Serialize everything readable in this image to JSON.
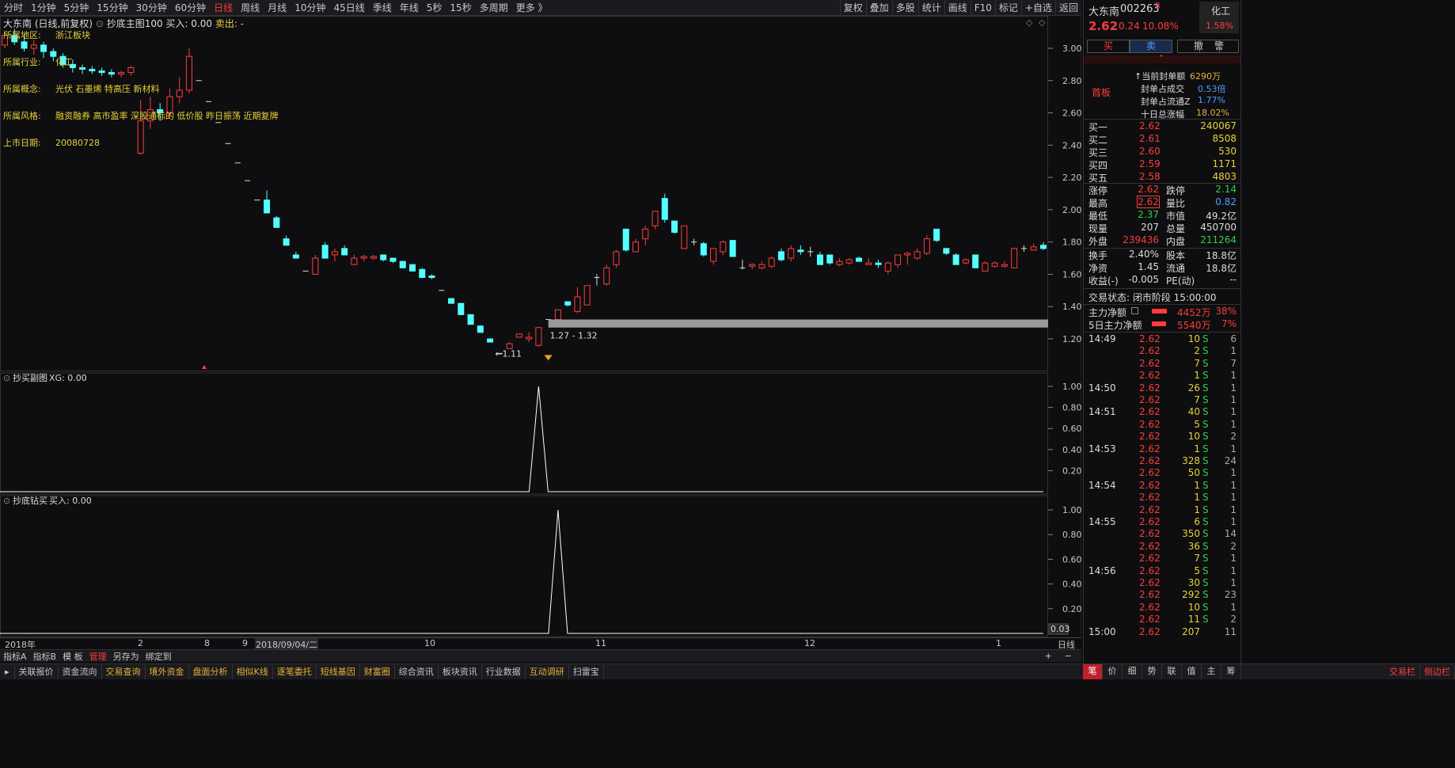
{
  "toolbar": {
    "periods": [
      "分时",
      "1分钟",
      "5分钟",
      "15分钟",
      "30分钟",
      "60分钟",
      "日线",
      "周线",
      "月线",
      "10分钟",
      "45日线",
      "季线",
      "年线",
      "5秒",
      "15秒",
      "多周期",
      "更多 》"
    ],
    "active_period": "日线",
    "right_tools": [
      "复权",
      "叠加",
      "多股",
      "统计",
      "画线",
      "F10",
      "标记",
      "+自选",
      "返回"
    ]
  },
  "chart_header": {
    "stock": "大东南 (日线,前复权)",
    "indicator": "抄底主图100",
    "buy": "买入: 0.00",
    "sell": "卖出: -"
  },
  "info": [
    {
      "k": "所属地区:",
      "v": "浙江板块"
    },
    {
      "k": "所属行业:",
      "v": "化工"
    },
    {
      "k": "所属概念:",
      "v": "光伏 石墨烯 特高压 新材料"
    },
    {
      "k": "所属风格:",
      "v": "融资融券 高市盈率 深股通标的 低价股 昨日振荡 近期复牌"
    },
    {
      "k": "上市日期:",
      "v": "20080728"
    }
  ],
  "price_axis": [
    "3.00",
    "2.80",
    "2.60",
    "2.40",
    "2.20",
    "2.00",
    "1.80",
    "1.60",
    "1.40",
    "1.20"
  ],
  "annotations": {
    "low_label": "1.11",
    "range_label": "1.27 - 1.32"
  },
  "sub1": {
    "title": "抄买副图",
    "value": "XG: 0.00",
    "axis": [
      "1.00",
      "0.80",
      "0.60",
      "0.40",
      "0.20"
    ]
  },
  "sub2": {
    "title": "抄底钻买",
    "value": "买入: 0.00",
    "axis": [
      "1.00",
      "0.80",
      "0.60",
      "0.40",
      "0.20"
    ],
    "corner": "0.03"
  },
  "date_axis": [
    {
      "t": "2018年"
    },
    {
      "t": "2"
    },
    {
      "t": "8"
    },
    {
      "t": "9"
    },
    {
      "t": "2018/09/04/二"
    },
    {
      "t": "10"
    },
    {
      "t": "11"
    },
    {
      "t": "12"
    },
    {
      "t": "1"
    }
  ],
  "date_axis_right": "日线",
  "tabs": [
    "指标A",
    "指标B",
    "模 板",
    "管理",
    "另存为",
    "绑定到"
  ],
  "tabs_active": "管理",
  "tabs_right": [
    "+",
    "−"
  ],
  "bottom": [
    "关联报价",
    "资金流向",
    "交易查询",
    "境外资金",
    "盘面分析",
    "相似K线",
    "逐笔委托",
    "短线基因",
    "财富圈",
    "综合资讯",
    "板块资讯",
    "行业数据",
    "互动调研",
    "扫雷宝"
  ],
  "bottom_right": [
    "交易栏",
    "侧边栏"
  ],
  "panel": {
    "name": "大东南",
    "code": "002263",
    "mark": "R",
    "sector": "化工",
    "price": "2.62",
    "change": "0.24",
    "pct": "10.08%",
    "sector_pct": "1.58%",
    "buttons": [
      "买",
      "卖",
      "撤",
      "警"
    ],
    "tag": "首板",
    "seal": [
      {
        "k": "当前封单额",
        "v": "6290万"
      },
      {
        "k": "封单占成交",
        "v": "0.53倍"
      },
      {
        "k": "封单占流通Z",
        "v": "1.77%"
      },
      {
        "k": "十日总涨幅",
        "v": "18.02%"
      }
    ],
    "bids": [
      {
        "k": "买一",
        "p": "2.62",
        "v": "240067"
      },
      {
        "k": "买二",
        "p": "2.61",
        "v": "8508"
      },
      {
        "k": "买三",
        "p": "2.60",
        "v": "530"
      },
      {
        "k": "买四",
        "p": "2.59",
        "v": "1171"
      },
      {
        "k": "买五",
        "p": "2.58",
        "v": "4803"
      }
    ],
    "stats": [
      {
        "k1": "涨停",
        "v1": "2.62",
        "k2": "跌停",
        "v2": "2.14"
      },
      {
        "k1": "最高",
        "v1": "2.62",
        "k2": "量比",
        "v2": "0.82"
      },
      {
        "k1": "最低",
        "v1": "2.37",
        "k2": "市值",
        "v2": "49.2亿"
      },
      {
        "k1": "现量",
        "v1": "207",
        "k2": "总量",
        "v2": "450700"
      },
      {
        "k1": "外盘",
        "v1": "239436",
        "k2": "内盘",
        "v2": "211264"
      }
    ],
    "stats2": [
      {
        "k1": "换手",
        "v1": "2.40%",
        "k2": "股本",
        "v2": "18.8亿"
      },
      {
        "k1": "净资",
        "v1": "1.45",
        "k2": "流通",
        "v2": "18.8亿"
      },
      {
        "k1": "收益(-)",
        "v1": "-0.005",
        "k2": "PE(动)",
        "v2": "--"
      }
    ],
    "status": "交易状态: 闭市阶段 15:00:00",
    "flows": [
      {
        "k": "主力净额",
        "v": "4452万",
        "p": "38%",
        "bar": 0.38
      },
      {
        "k": "5日主力净额",
        "v": "5540万",
        "p": "7%",
        "bar": 0.07
      }
    ],
    "ticks": [
      {
        "t": "14:49",
        "p": "2.62",
        "v": "10",
        "s": "S",
        "n": "6"
      },
      {
        "t": "",
        "p": "2.62",
        "v": "2",
        "s": "S",
        "n": "1"
      },
      {
        "t": "",
        "p": "2.62",
        "v": "7",
        "s": "S",
        "n": "7"
      },
      {
        "t": "",
        "p": "2.62",
        "v": "1",
        "s": "S",
        "n": "1"
      },
      {
        "t": "14:50",
        "p": "2.62",
        "v": "26",
        "s": "S",
        "n": "1"
      },
      {
        "t": "",
        "p": "2.62",
        "v": "7",
        "s": "S",
        "n": "1"
      },
      {
        "t": "14:51",
        "p": "2.62",
        "v": "40",
        "s": "S",
        "n": "1"
      },
      {
        "t": "",
        "p": "2.62",
        "v": "5",
        "s": "S",
        "n": "1"
      },
      {
        "t": "",
        "p": "2.62",
        "v": "10",
        "s": "S",
        "n": "2"
      },
      {
        "t": "14:53",
        "p": "2.62",
        "v": "1",
        "s": "S",
        "n": "1"
      },
      {
        "t": "",
        "p": "2.62",
        "v": "328",
        "s": "S",
        "n": "24"
      },
      {
        "t": "",
        "p": "2.62",
        "v": "50",
        "s": "S",
        "n": "1"
      },
      {
        "t": "14:54",
        "p": "2.62",
        "v": "1",
        "s": "S",
        "n": "1"
      },
      {
        "t": "",
        "p": "2.62",
        "v": "1",
        "s": "S",
        "n": "1"
      },
      {
        "t": "",
        "p": "2.62",
        "v": "1",
        "s": "S",
        "n": "1"
      },
      {
        "t": "14:55",
        "p": "2.62",
        "v": "6",
        "s": "S",
        "n": "1"
      },
      {
        "t": "",
        "p": "2.62",
        "v": "350",
        "s": "S",
        "n": "14"
      },
      {
        "t": "",
        "p": "2.62",
        "v": "36",
        "s": "S",
        "n": "2"
      },
      {
        "t": "",
        "p": "2.62",
        "v": "7",
        "s": "S",
        "n": "1"
      },
      {
        "t": "14:56",
        "p": "2.62",
        "v": "5",
        "s": "S",
        "n": "1"
      },
      {
        "t": "",
        "p": "2.62",
        "v": "30",
        "s": "S",
        "n": "1"
      },
      {
        "t": "",
        "p": "2.62",
        "v": "292",
        "s": "S",
        "n": "23"
      },
      {
        "t": "",
        "p": "2.62",
        "v": "10",
        "s": "S",
        "n": "1"
      },
      {
        "t": "",
        "p": "2.62",
        "v": "11",
        "s": "S",
        "n": "2"
      },
      {
        "t": "15:00",
        "p": "2.62",
        "v": "207",
        "s": "",
        "n": "11"
      }
    ],
    "bottom_tabs": [
      "笔",
      "价",
      "细",
      "势",
      "联",
      "值",
      "主",
      "筹"
    ],
    "bottom_active": "笔"
  },
  "colors": {
    "up": "#ff3b3b",
    "down": "#54ffff",
    "bg": "#0e0e10",
    "yellow": "#e6d23a"
  },
  "candles": [
    [
      3.02,
      3.1,
      3.0,
      3.08
    ],
    [
      3.08,
      3.12,
      3.02,
      3.04
    ],
    [
      3.04,
      3.08,
      2.98,
      3.0
    ],
    [
      3.0,
      3.05,
      2.96,
      3.02
    ],
    [
      3.02,
      3.04,
      2.94,
      2.98
    ],
    [
      2.98,
      3.0,
      2.92,
      2.95
    ],
    [
      2.95,
      2.97,
      2.88,
      2.9
    ],
    [
      2.9,
      2.93,
      2.85,
      2.88
    ],
    [
      2.88,
      2.9,
      2.84,
      2.87
    ],
    [
      2.87,
      2.89,
      2.84,
      2.86
    ],
    [
      2.86,
      2.88,
      2.83,
      2.85
    ],
    [
      2.85,
      2.87,
      2.82,
      2.84
    ],
    [
      2.84,
      2.86,
      2.82,
      2.85
    ],
    [
      2.85,
      2.89,
      2.83,
      2.88
    ],
    [
      2.35,
      2.68,
      2.34,
      2.55
    ],
    [
      2.55,
      2.7,
      2.5,
      2.62
    ],
    [
      2.62,
      2.66,
      2.55,
      2.6
    ],
    [
      2.6,
      2.75,
      2.56,
      2.7
    ],
    [
      2.7,
      2.82,
      2.66,
      2.74
    ],
    [
      2.74,
      3.0,
      2.72,
      2.95
    ],
    [
      2.8,
      2.8,
      2.8,
      2.8
    ],
    [
      2.67,
      2.67,
      2.67,
      2.67
    ],
    [
      2.54,
      2.54,
      2.54,
      2.54
    ],
    [
      2.41,
      2.41,
      2.41,
      2.41
    ],
    [
      2.29,
      2.29,
      2.29,
      2.29
    ],
    [
      2.18,
      2.18,
      2.18,
      2.18
    ],
    [
      2.06,
      2.06,
      2.06,
      2.06
    ],
    [
      2.06,
      2.12,
      1.98,
      1.98
    ],
    [
      1.95,
      1.96,
      1.89,
      1.89
    ],
    [
      1.82,
      1.84,
      1.78,
      1.78
    ],
    [
      1.72,
      1.74,
      1.7,
      1.7
    ],
    [
      1.62,
      1.62,
      1.62,
      1.62
    ],
    [
      1.6,
      1.72,
      1.6,
      1.7
    ],
    [
      1.78,
      1.8,
      1.7,
      1.7
    ],
    [
      1.72,
      1.76,
      1.68,
      1.74
    ],
    [
      1.76,
      1.78,
      1.72,
      1.72
    ],
    [
      1.66,
      1.72,
      1.66,
      1.7
    ],
    [
      1.7,
      1.72,
      1.68,
      1.71
    ],
    [
      1.7,
      1.72,
      1.69,
      1.71
    ],
    [
      1.72,
      1.72,
      1.68,
      1.69
    ],
    [
      1.7,
      1.7,
      1.67,
      1.68
    ],
    [
      1.68,
      1.68,
      1.64,
      1.64
    ],
    [
      1.66,
      1.66,
      1.62,
      1.62
    ],
    [
      1.63,
      1.64,
      1.58,
      1.58
    ],
    [
      1.59,
      1.6,
      1.57,
      1.58
    ],
    [
      1.5,
      1.5,
      1.5,
      1.5
    ],
    [
      1.45,
      1.45,
      1.42,
      1.42
    ],
    [
      1.42,
      1.42,
      1.35,
      1.35
    ],
    [
      1.35,
      1.35,
      1.29,
      1.29
    ],
    [
      1.28,
      1.28,
      1.24,
      1.24
    ],
    [
      1.2,
      1.2,
      1.18,
      1.18
    ],
    [
      1.11,
      1.11,
      1.11,
      1.11
    ],
    [
      1.14,
      1.18,
      1.14,
      1.17
    ],
    [
      1.21,
      1.23,
      1.21,
      1.23
    ],
    [
      1.2,
      1.24,
      1.18,
      1.21
    ],
    [
      1.16,
      1.27,
      1.15,
      1.27
    ],
    [
      1.32,
      1.32,
      1.32,
      1.32
    ],
    [
      1.32,
      1.38,
      1.32,
      1.38
    ],
    [
      1.43,
      1.43,
      1.4,
      1.41
    ],
    [
      1.37,
      1.52,
      1.36,
      1.46
    ],
    [
      1.41,
      1.53,
      1.41,
      1.53
    ],
    [
      1.58,
      1.6,
      1.53,
      1.58
    ],
    [
      1.54,
      1.66,
      1.53,
      1.64
    ],
    [
      1.66,
      1.75,
      1.64,
      1.74
    ],
    [
      1.88,
      1.88,
      1.74,
      1.75
    ],
    [
      1.74,
      1.82,
      1.74,
      1.8
    ],
    [
      1.82,
      1.9,
      1.78,
      1.88
    ],
    [
      1.9,
      1.99,
      1.88,
      1.99
    ],
    [
      2.07,
      2.1,
      1.92,
      1.94
    ],
    [
      1.93,
      1.93,
      1.85,
      1.86
    ],
    [
      1.76,
      1.9,
      1.76,
      1.9
    ],
    [
      1.8,
      1.82,
      1.78,
      1.8
    ],
    [
      1.79,
      1.8,
      1.71,
      1.72
    ],
    [
      1.68,
      1.76,
      1.66,
      1.76
    ],
    [
      1.74,
      1.81,
      1.72,
      1.8
    ],
    [
      1.81,
      1.81,
      1.71,
      1.71
    ],
    [
      1.64,
      1.69,
      1.63,
      1.64
    ],
    [
      1.65,
      1.67,
      1.63,
      1.66
    ],
    [
      1.64,
      1.68,
      1.63,
      1.66
    ],
    [
      1.65,
      1.71,
      1.64,
      1.7
    ],
    [
      1.74,
      1.76,
      1.68,
      1.69
    ],
    [
      1.7,
      1.78,
      1.68,
      1.76
    ],
    [
      1.75,
      1.78,
      1.72,
      1.74
    ],
    [
      1.74,
      1.77,
      1.71,
      1.74
    ],
    [
      1.72,
      1.74,
      1.66,
      1.66
    ],
    [
      1.72,
      1.72,
      1.66,
      1.67
    ],
    [
      1.66,
      1.7,
      1.65,
      1.68
    ],
    [
      1.67,
      1.7,
      1.66,
      1.69
    ],
    [
      1.7,
      1.71,
      1.68,
      1.68
    ],
    [
      1.66,
      1.7,
      1.66,
      1.67
    ],
    [
      1.67,
      1.69,
      1.64,
      1.66
    ],
    [
      1.62,
      1.68,
      1.6,
      1.67
    ],
    [
      1.66,
      1.72,
      1.64,
      1.72
    ],
    [
      1.72,
      1.74,
      1.66,
      1.73
    ],
    [
      1.7,
      1.76,
      1.69,
      1.74
    ],
    [
      1.73,
      1.84,
      1.72,
      1.82
    ],
    [
      1.88,
      1.88,
      1.8,
      1.81
    ],
    [
      1.76,
      1.76,
      1.72,
      1.73
    ],
    [
      1.72,
      1.73,
      1.66,
      1.66
    ],
    [
      1.67,
      1.7,
      1.66,
      1.69
    ],
    [
      1.72,
      1.72,
      1.64,
      1.64
    ],
    [
      1.62,
      1.68,
      1.62,
      1.67
    ],
    [
      1.65,
      1.68,
      1.64,
      1.67
    ],
    [
      1.65,
      1.68,
      1.64,
      1.66
    ],
    [
      1.64,
      1.76,
      1.64,
      1.76
    ],
    [
      1.76,
      1.78,
      1.74,
      1.76
    ],
    [
      1.75,
      1.79,
      1.75,
      1.77
    ],
    [
      1.78,
      1.8,
      1.75,
      1.76
    ]
  ],
  "sub1_spike_index": 55,
  "sub2_spike_index": 57
}
